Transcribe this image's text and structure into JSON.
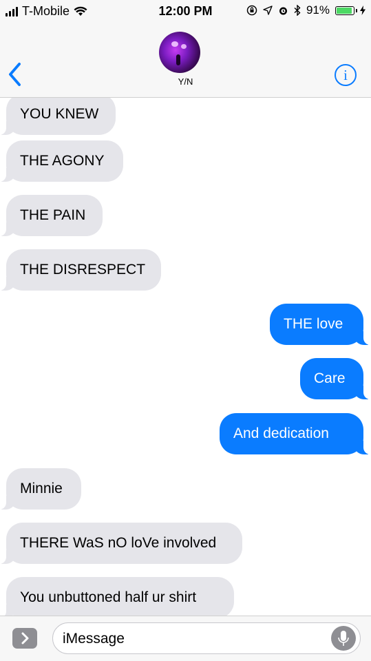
{
  "status_bar": {
    "carrier": "T-Mobile",
    "time": "12:00 PM",
    "battery_percent": "91%",
    "battery_level": 0.91,
    "icons": [
      "signal-icon",
      "wifi-icon",
      "orientation-lock-icon",
      "location-icon",
      "alarm-icon",
      "bluetooth-icon",
      "battery-icon",
      "charging-icon"
    ]
  },
  "header": {
    "contact_name": "Y/N",
    "back_icon": "chevron-left-icon",
    "info_icon": "info-icon"
  },
  "messages": [
    {
      "text": "YOU KNEW",
      "direction": "incoming"
    },
    {
      "text": "THE AGONY",
      "direction": "incoming"
    },
    {
      "text": "THE PAIN",
      "direction": "incoming"
    },
    {
      "text": "THE DISRESPECT",
      "direction": "incoming"
    },
    {
      "text": "THE love",
      "direction": "outgoing"
    },
    {
      "text": "Care",
      "direction": "outgoing"
    },
    {
      "text": "And dedication",
      "direction": "outgoing"
    },
    {
      "text": "Minnie",
      "direction": "incoming"
    },
    {
      "text": "THERE WaS nO loVe involved",
      "direction": "incoming"
    },
    {
      "text": "You unbuttoned half ur shirt",
      "direction": "incoming"
    }
  ],
  "input": {
    "placeholder": "iMessage",
    "apps_icon": "chevron-right-icon",
    "mic_icon": "microphone-icon"
  },
  "colors": {
    "outgoing_bubble": "#0a7cff",
    "incoming_bubble": "#e5e5ea",
    "accent": "#0a7cff",
    "battery_green": "#4cd964"
  }
}
